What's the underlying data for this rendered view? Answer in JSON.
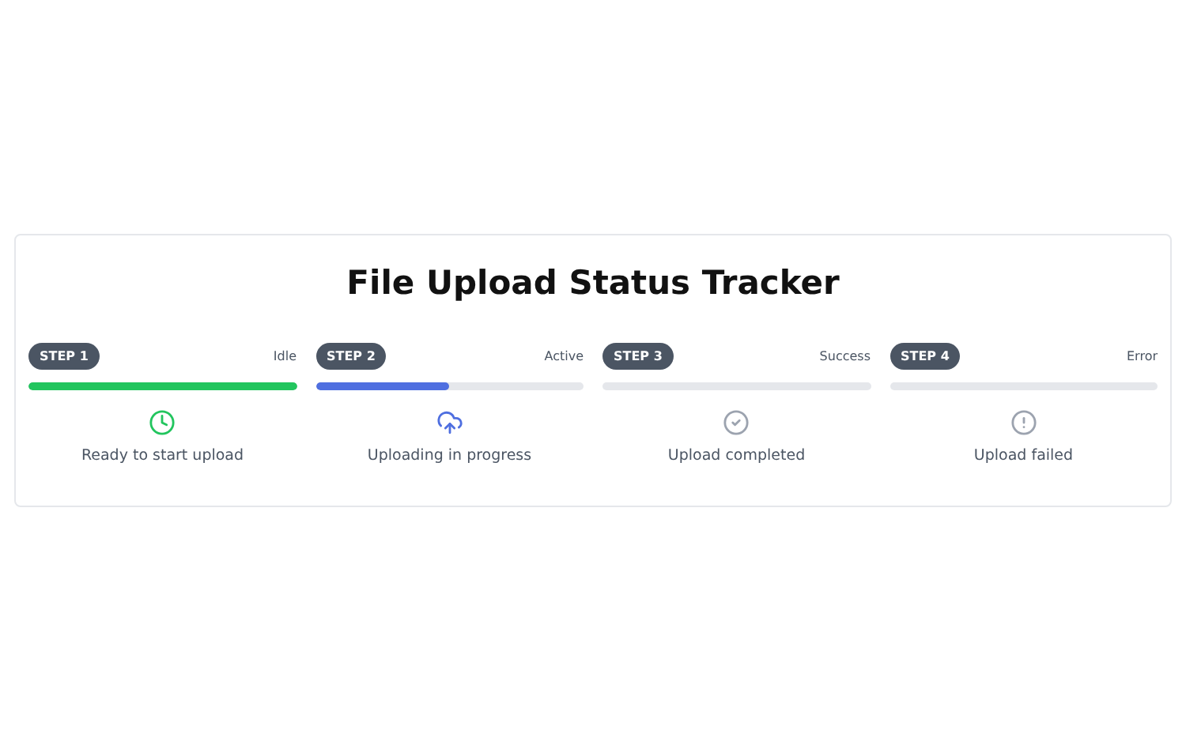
{
  "title": "File Upload Status Tracker",
  "steps": [
    {
      "badge": "STEP 1",
      "status": "Idle",
      "level": 1,
      "color": "#22c55e",
      "kind": "clock",
      "message": "Ready to start upload"
    },
    {
      "badge": "STEP 2",
      "status": "Active",
      "level": 0.5,
      "color": "#4f6fe0",
      "kind": "upload",
      "message": "Uploading in progress"
    },
    {
      "badge": "STEP 3",
      "status": "Success",
      "level": 0,
      "color": "#9ca3af",
      "kind": "check",
      "message": "Upload completed"
    },
    {
      "badge": "STEP 4",
      "status": "Error",
      "level": 0,
      "color": "#9ca3af",
      "kind": "alert",
      "message": "Upload failed"
    }
  ]
}
